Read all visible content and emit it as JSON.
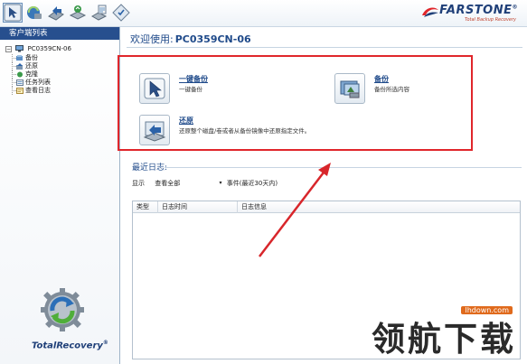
{
  "toolbar": {
    "buttons": [
      {
        "name": "one-click-backup-tool",
        "icon": "cursor-icon"
      },
      {
        "name": "backup-tool",
        "icon": "backup-icon"
      },
      {
        "name": "restore-tool",
        "icon": "restore-icon"
      },
      {
        "name": "clone-tool",
        "icon": "clone-icon"
      },
      {
        "name": "task-tool",
        "icon": "task-icon"
      },
      {
        "name": "log-tool",
        "icon": "log-icon"
      }
    ]
  },
  "brand": {
    "name": "FARSTONE",
    "reg": "®",
    "subtitle": "Total Backup Recovery"
  },
  "sidebar": {
    "header": "客户端列表",
    "root": "PC0359CN-06",
    "root_expander": "−",
    "items": [
      {
        "label": "备份",
        "icon": "backup-item-icon"
      },
      {
        "label": "还原",
        "icon": "restore-item-icon"
      },
      {
        "label": "克隆",
        "icon": "clone-item-icon"
      },
      {
        "label": "任务列表",
        "icon": "task-list-icon"
      },
      {
        "label": "查看日志",
        "icon": "view-log-icon"
      }
    ],
    "logo_text": "TotalRecovery",
    "logo_reg": "®"
  },
  "main": {
    "welcome_label": "欢迎使用:",
    "welcome_pc": "PC0359CN-06",
    "actions": [
      {
        "title": "一键备份",
        "desc": "一键备份"
      },
      {
        "title": "备份",
        "desc": "备份所选内容"
      },
      {
        "title": "还原",
        "desc": "还原整个磁盘/卷或者从备份镜像中还原指定文件。"
      }
    ],
    "logs": {
      "title": "最近日志:",
      "show_label": "显示",
      "filter_value": "查看全部",
      "filter_arrow": "▾",
      "event_label": "事件(最近30天内)",
      "columns": [
        "类型",
        "日志时间",
        "日志信息"
      ]
    }
  },
  "watermark": {
    "text": "领航下载",
    "site": "lhdown.com"
  },
  "colors": {
    "accent": "#1f4a8a",
    "sidebar_header": "#274f8e",
    "highlight": "#e0262b"
  }
}
